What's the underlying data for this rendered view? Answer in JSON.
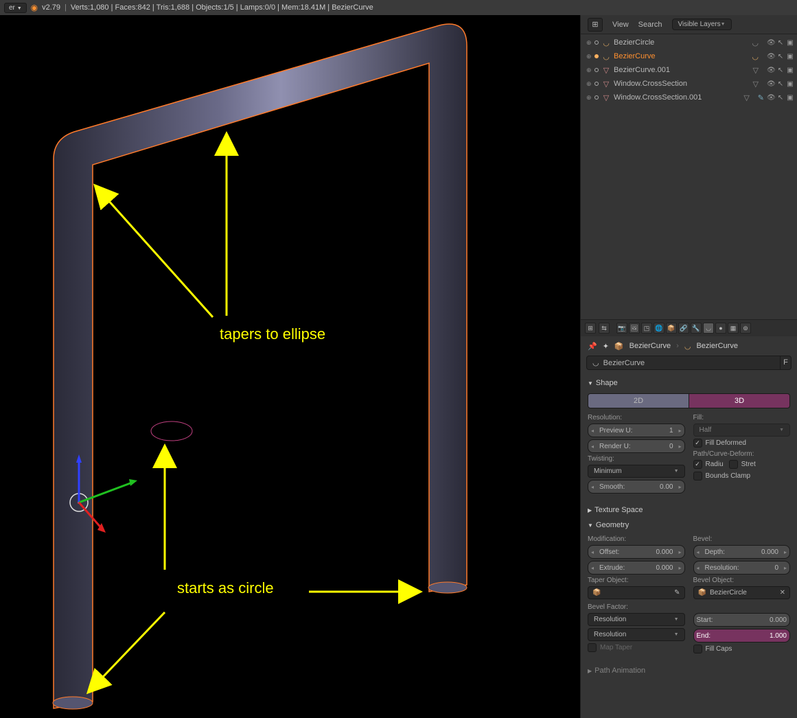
{
  "topbar": {
    "er_label": "er",
    "version": "v2.79",
    "stats": "Verts:1,080 | Faces:842 | Tris:1,688 | Objects:1/5 | Lamps:0/0 | Mem:18.41M | BezierCurve"
  },
  "annotations": {
    "tapers": "tapers to ellipse",
    "starts": "starts as circle"
  },
  "outliner": {
    "view": "View",
    "search": "Search",
    "visible_layers": "Visible Layers",
    "items": [
      {
        "name": "BezierCircle",
        "type": "curve",
        "sel": false
      },
      {
        "name": "BezierCurve",
        "type": "curve",
        "sel": true
      },
      {
        "name": "BezierCurve.001",
        "type": "mesh",
        "sel": false
      },
      {
        "name": "Window.CrossSection",
        "type": "mesh",
        "sel": false
      },
      {
        "name": "Window.CrossSection.001",
        "type": "mesh",
        "sel": false
      }
    ]
  },
  "props": {
    "bc_obj": "BezierCurve",
    "bc_data": "BezierCurve",
    "name": "BezierCurve",
    "f": "F",
    "shape": {
      "title": "Shape",
      "dim2d": "2D",
      "dim3d": "3D",
      "resolution_lbl": "Resolution:",
      "preview_u": "Preview U:",
      "preview_u_val": "1",
      "render_u": "Render U:",
      "render_u_val": "0",
      "twisting_lbl": "Twisting:",
      "twist_method": "Minimum",
      "smooth": "Smooth:",
      "smooth_val": "0.00",
      "fill_lbl": "Fill:",
      "fill_mode": "Half",
      "fill_deformed": "Fill Deformed",
      "path_lbl": "Path/Curve-Deform:",
      "radiu": "Radiu",
      "stret": "Stret",
      "bounds": "Bounds Clamp"
    },
    "tex_space": "Texture Space",
    "geometry": {
      "title": "Geometry",
      "modification_lbl": "Modification:",
      "offset": "Offset:",
      "offset_val": "0.000",
      "extrude": "Extrude:",
      "extrude_val": "0.000",
      "taper_lbl": "Taper Object:",
      "bevel_lbl": "Bevel:",
      "depth": "Depth:",
      "depth_val": "0.000",
      "resolution": "Resolution:",
      "resolution_val": "0",
      "bevel_obj_lbl": "Bevel Object:",
      "bevel_obj": "BezierCircle",
      "bevel_factor_lbl": "Bevel Factor:",
      "bf_res": "Resolution",
      "bf_start": "Start:",
      "bf_start_val": "0.000",
      "bf_end": "End:",
      "bf_end_val": "1.000",
      "map_taper": "Map Taper",
      "fill_caps": "Fill Caps",
      "path_anim": "Path Animation"
    }
  }
}
